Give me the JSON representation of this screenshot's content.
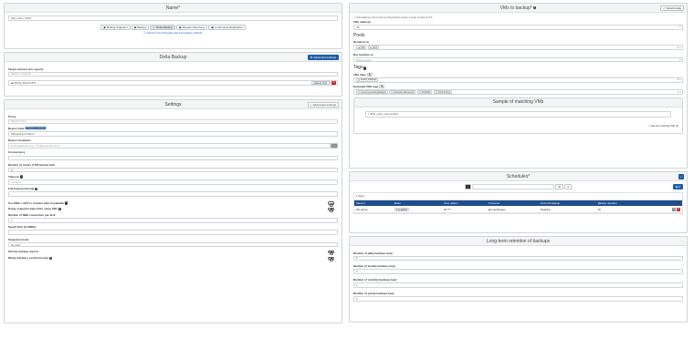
{
  "name_panel": {
    "title": "Name*",
    "name_value": "Win_vatm_TEST",
    "modes": [
      "Rolling Snapshot",
      "Backup",
      "Delta Backup",
      "Disaster Recovery",
      "Continuous Replication"
    ],
    "active_mode": "Delta Backup",
    "mode_help": "Click for more information about the backup methods."
  },
  "delta_backup": {
    "title": "Delta Backup",
    "advanced_settings": "Advanced settings",
    "target_label": "Target remotes (for export)",
    "target_placeholder": "Select remote(s)...",
    "remote_item": "DS03_BACKUPS",
    "delete_first_label": "Delete first"
  },
  "settings": {
    "title": "Settings",
    "add_preset": "Add preset settings",
    "proxy_label": "Proxy",
    "proxy_placeholder": "Select proxy...",
    "report_when_label": "Report when",
    "report_when_badge": "Property reviewer",
    "report_when_value": "Skipped and failure",
    "report_recipients_label": "Report recipients",
    "report_recipients_placeholder": "Email address (e.g.: foo@example.com)",
    "concurrency_label": "Concurrency",
    "retries_label": "Number of retries if VM backup fails",
    "retries_value": "0",
    "timeout_label": "Timeout",
    "timeout_placeholder": "In hours",
    "full_interval_label": "Full backup interval",
    "nbd_label": "Use NBD + CBT to transfer disk if available",
    "purge_label": "Purge snapshot data when using CBT",
    "nbd_connections_label": "Number of NBD connection per disk",
    "nbd_connections_value": "1",
    "speed_label": "Speed limit (in MiB/s)",
    "snapshot_mode_label": "Snapshot mode",
    "snapshot_mode_value": "Normal",
    "shorter_label": "Shorter backup reports",
    "async_label": "Merge backups synchronously"
  },
  "vms_panel": {
    "title": "VMs to backup*",
    "smart_mode": "Smart mode",
    "notice": "Delta Backup and Continuous Replication require at least XenServer 6.5.",
    "statuses_label": "VMs statuses",
    "statuses_value": "All",
    "pools_heading": "Pools",
    "resident_label": "Resident on",
    "resident_tags": [
      "lab",
      "pool"
    ],
    "not_resident_label": "Not resident on",
    "not_resident_placeholder": "Select pools...",
    "tags_heading": "Tags",
    "vm_tags_label": "VMs Tags",
    "vm_tags_value": "smart_backup",
    "excluded_label": "Excluded VMs tags",
    "excluded_tags": [
      "Continuous Replication",
      "Disaster Recovery",
      "PGSAN",
      "XOA Proxy"
    ],
    "sample_title": "Sample of matching VMs",
    "sample_vm": "Win_vatm_test (public)",
    "see_all": "See the matching VMs (1)"
  },
  "schedules": {
    "title": "Schedules*",
    "items_count": "1 items",
    "columns": [
      "Name",
      "Mode",
      "Cron pattern",
      "Timezone",
      "Force full backup",
      "Backup retention"
    ],
    "rows": [
      {
        "name": "Wir-dense",
        "mode": "Enabled",
        "cron": "00 ****",
        "timezone": "Europe/Prague",
        "force_full": "Disabled",
        "retention": "20"
      }
    ]
  },
  "ltr": {
    "title": "Long-term retention of backups",
    "daily_label": "Number of daily backups kept",
    "daily_value": "5",
    "weekly_label": "Number of weekly backups kept",
    "weekly_value": "2",
    "monthly_label": "Number of monthly backups kept",
    "monthly_value": "1",
    "yearly_label": "Number of yearly backups kept",
    "yearly_value": "1"
  },
  "colors": {
    "primary": "#1f5da8",
    "table_header": "#1f4e8c",
    "danger": "#c9302c"
  }
}
